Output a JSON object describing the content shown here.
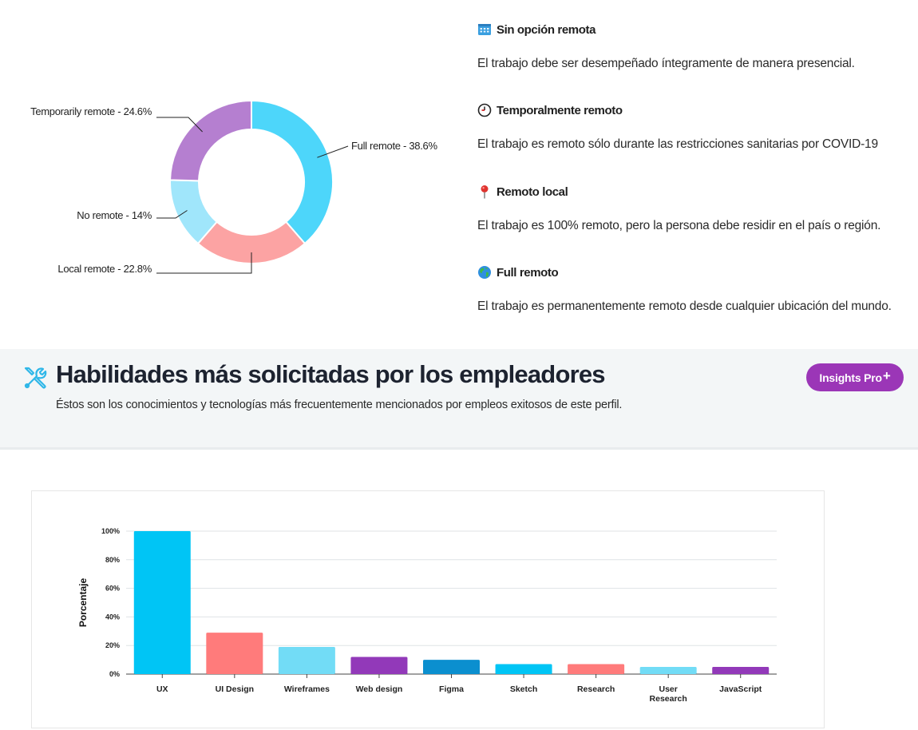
{
  "donut": {
    "segments": [
      {
        "label": "Full remote - 38.6%",
        "value": 38.6,
        "color": "#4dd6fa"
      },
      {
        "label": "Local remote - 22.8%",
        "value": 22.8,
        "color": "#fca3a3"
      },
      {
        "label": "No remote - 14%",
        "value": 14,
        "color": "#a0e6fb"
      },
      {
        "label": "Temporarily remote - 24.6%",
        "value": 24.6,
        "color": "#b57fd0"
      }
    ]
  },
  "legend": {
    "items": [
      {
        "icon": "office-building-icon",
        "title": "Sin opción remota",
        "desc": "El trabajo debe ser desempeñado íntegramente de manera presencial."
      },
      {
        "icon": "clock-icon",
        "title": "Temporalmente remoto",
        "desc": "El trabajo es remoto sólo durante las restricciones sanitarias por COVID-19"
      },
      {
        "icon": "pushpin-icon",
        "title": "Remoto local",
        "desc": "El trabajo es 100% remoto, pero la persona debe residir en el país o región."
      },
      {
        "icon": "globe-icon",
        "title": "Full remoto",
        "desc": "El trabajo es permanentemente remoto desde cualquier ubicación del mundo."
      }
    ]
  },
  "skills": {
    "icon": "tools-icon",
    "title": "Habilidades más solicitadas por los empleadores",
    "subtitle": "Éstos son los conocimientos y tecnologías más frecuentemente mencionados por empleos exitosos de este perfil.",
    "pro_label": "Insights Pro",
    "pro_plus": "+"
  },
  "chart_data": {
    "type": "bar",
    "categories": [
      "UX",
      "UI Design",
      "Wireframes",
      "Web design",
      "Figma",
      "Sketch",
      "Research",
      "User Research",
      "JavaScript"
    ],
    "category_lines": [
      [
        "UX"
      ],
      [
        "UI Design"
      ],
      [
        "Wireframes"
      ],
      [
        "Web design"
      ],
      [
        "Figma"
      ],
      [
        "Sketch"
      ],
      [
        "Research"
      ],
      [
        "User",
        "Research"
      ],
      [
        "JavaScript"
      ]
    ],
    "values": [
      100,
      29,
      19,
      12,
      10,
      7,
      7,
      5,
      5
    ],
    "colors": [
      "#00c5f5",
      "#ff7b7b",
      "#72dcf6",
      "#9239b9",
      "#0b8fcf",
      "#00c5f5",
      "#ff7b7b",
      "#72dcf6",
      "#9239b9"
    ],
    "ylabel": "Porcentaje",
    "yticks": [
      "0%",
      "20%",
      "40%",
      "60%",
      "80%",
      "100%"
    ],
    "ylim": [
      0,
      100
    ],
    "grid": true
  }
}
